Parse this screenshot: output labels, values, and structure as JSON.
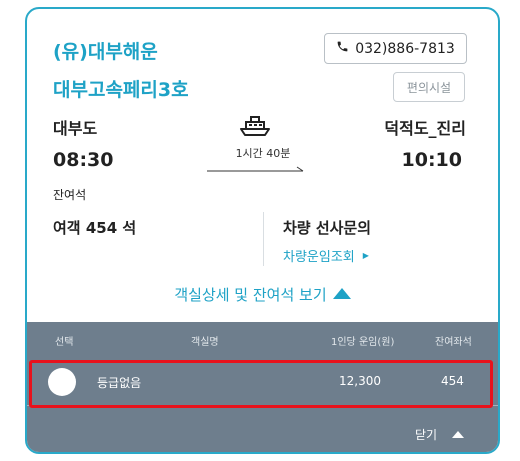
{
  "header": {
    "company": "(유)대부해운",
    "ship_name": "대부고속페리3호",
    "phone": "032)886-7813",
    "amenities_label": "편의시설"
  },
  "route": {
    "departure_port": "대부도",
    "departure_time": "08:30",
    "arrival_port": "덕적도_진리",
    "arrival_time": "10:10",
    "duration": "1시간 40분"
  },
  "seats": {
    "label": "잔여석",
    "passenger": "여객 454 석",
    "vehicle_title": "차량 선사문의",
    "vehicle_link": "차량운임조회"
  },
  "detail_toggle_label": "객실상세 및 잔여석 보기",
  "table": {
    "headers": [
      "선택",
      "객실명",
      "1인당 운임(원)",
      "잔여좌석"
    ],
    "rows": [
      {
        "cabin": "등급없음",
        "fare": "12,300",
        "remaining": "454"
      }
    ],
    "close_label": "닫기"
  },
  "colors": {
    "accent": "#1ea2c6",
    "panel": "#6e7e8d",
    "highlight": "#e8121c"
  }
}
